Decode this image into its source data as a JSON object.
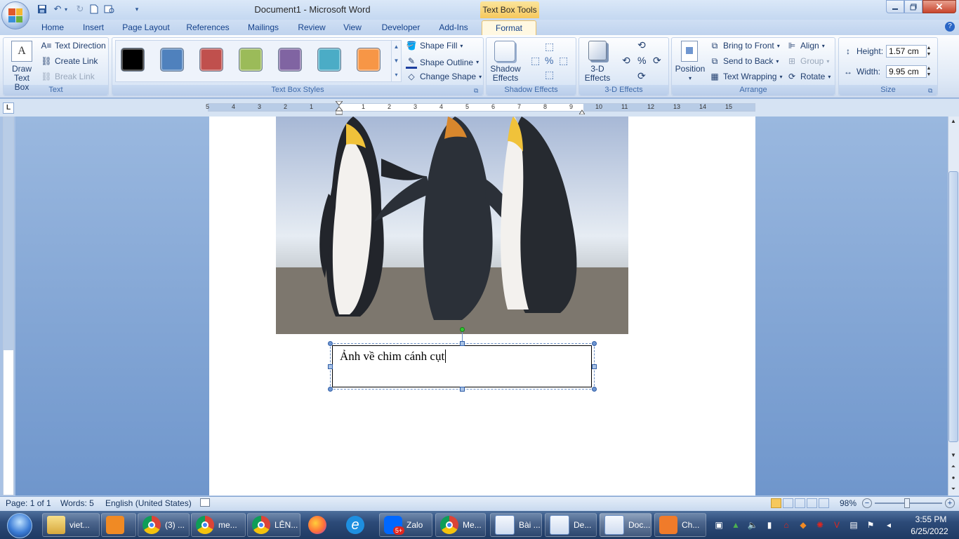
{
  "title_bar": {
    "document_title": "Document1 - Microsoft Word",
    "contextual_tab_group": "Text Box Tools"
  },
  "tabs": [
    {
      "label": "Home"
    },
    {
      "label": "Insert"
    },
    {
      "label": "Page Layout"
    },
    {
      "label": "References"
    },
    {
      "label": "Mailings"
    },
    {
      "label": "Review"
    },
    {
      "label": "View"
    },
    {
      "label": "Developer"
    },
    {
      "label": "Add-Ins"
    },
    {
      "label": "Format",
      "active": true
    }
  ],
  "ribbon": {
    "text_group": {
      "label": "Text",
      "draw_text_box": "Draw\nText Box",
      "draw_text_box_line1": "Draw",
      "draw_text_box_line2": "Text Box",
      "text_direction": "Text Direction",
      "create_link": "Create Link",
      "break_link": "Break Link"
    },
    "text_box_styles_group": {
      "label": "Text Box Styles",
      "swatches": [
        "#000000",
        "#4f81bd",
        "#c0504d",
        "#9bbb59",
        "#8064a2",
        "#4bacc6",
        "#f79646"
      ],
      "shape_fill": "Shape Fill",
      "shape_outline": "Shape Outline",
      "change_shape": "Change Shape"
    },
    "shadow_effects_group": {
      "label": "Shadow Effects",
      "shadow_effects_line1": "Shadow",
      "shadow_effects_line2": "Effects"
    },
    "three_d_effects_group": {
      "label": "3-D Effects",
      "three_d_line1": "3-D",
      "three_d_line2": "Effects"
    },
    "arrange_group": {
      "label": "Arrange",
      "position": "Position",
      "bring_to_front": "Bring to Front",
      "send_to_back": "Send to Back",
      "text_wrapping": "Text Wrapping",
      "align": "Align",
      "group": "Group",
      "rotate": "Rotate"
    },
    "size_group": {
      "label": "Size",
      "height_label": "Height:",
      "height_value": "1.57 cm",
      "width_label": "Width:",
      "width_value": "9.95 cm"
    }
  },
  "ruler": {
    "corner": "L",
    "ticks": [
      "5",
      "4",
      "3",
      "2",
      "1",
      "1",
      "2",
      "3",
      "4",
      "5",
      "6",
      "7",
      "8",
      "9",
      "10",
      "11",
      "12",
      "13",
      "14",
      "15"
    ]
  },
  "document": {
    "textbox_text": "Ảnh về chim cánh cụt"
  },
  "status_bar": {
    "page": "Page: 1 of 1",
    "words": "Words: 5",
    "language": "English (United States)",
    "zoom": "98%"
  },
  "taskbar": {
    "items": [
      {
        "label": "viet..."
      },
      {
        "label": ""
      },
      {
        "label": "(3) ..."
      },
      {
        "label": "me..."
      },
      {
        "label": "LÊN..."
      },
      {
        "label": ""
      },
      {
        "label": ""
      },
      {
        "label": "Zalo"
      },
      {
        "label": "Me..."
      },
      {
        "label": "Bài ..."
      },
      {
        "label": "De..."
      },
      {
        "label": "Doc..."
      },
      {
        "label": "Ch..."
      }
    ],
    "zalo_badge": "5+",
    "clock_time": "3:55 PM",
    "clock_date": "6/25/2022"
  }
}
